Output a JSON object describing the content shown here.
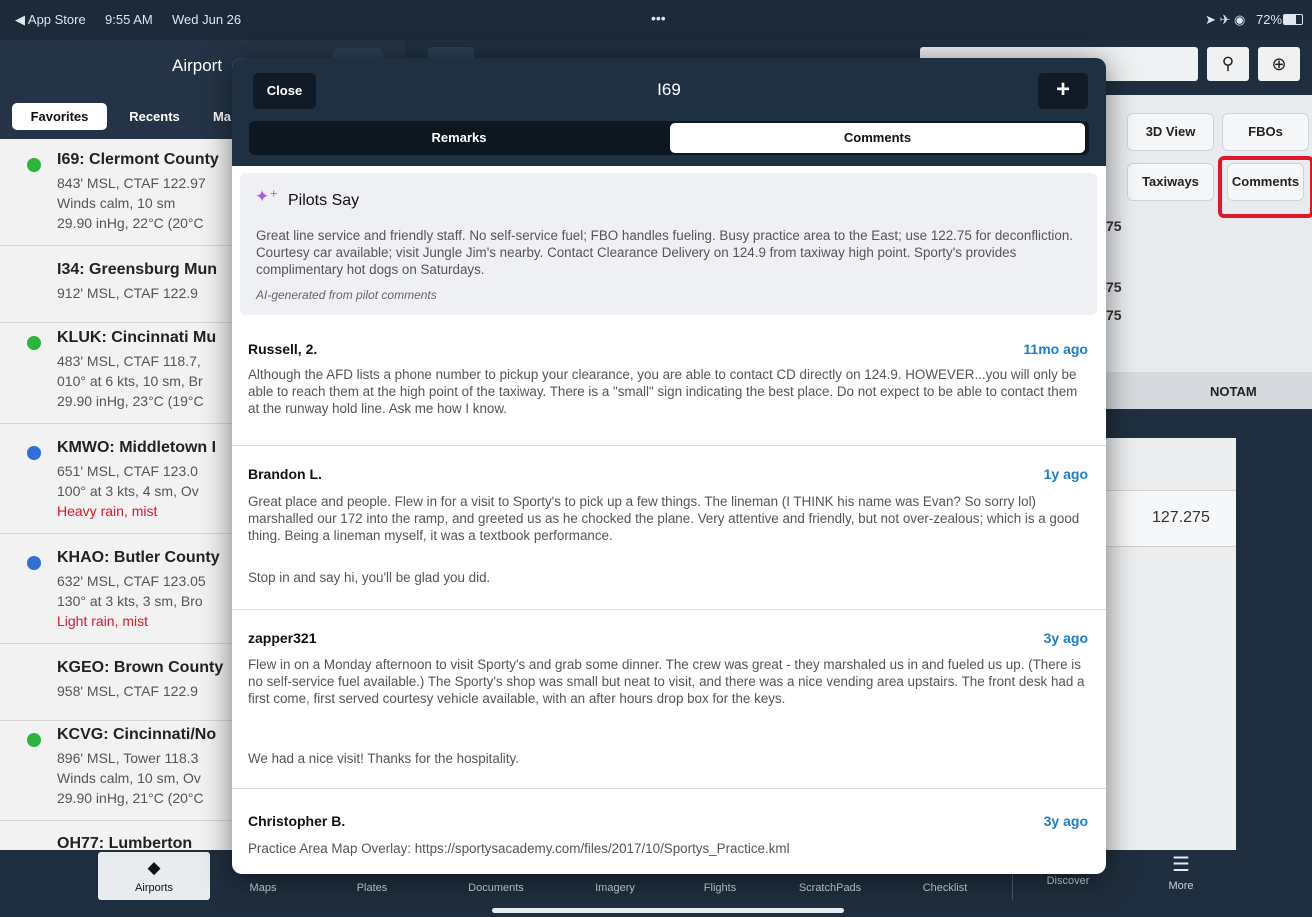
{
  "status_bar": {
    "back_label": "◀ App Store",
    "time": "9:55 AM",
    "date": "Wed Jun 26",
    "dots": "•••",
    "battery": "72%"
  },
  "left_panel": {
    "title": "Airport",
    "segments": [
      "Favorites",
      "Recents",
      "Ma"
    ],
    "airports": [
      {
        "name": "I69: Clermont County",
        "lines": [
          "843' MSL, CTAF 122.97",
          "Winds calm, 10 sm",
          "29.90 inHg, 22°C (20°C"
        ],
        "dot": "#2bb53c"
      },
      {
        "name": "I34: Greensburg Mun",
        "lines": [
          "912' MSL, CTAF 122.9"
        ],
        "dot": ""
      },
      {
        "name": "KLUK: Cincinnati Mu",
        "lines": [
          "483' MSL, CTAF 118.7,",
          "010° at 6 kts, 10 sm, Br",
          "29.90 inHg, 23°C (19°C"
        ],
        "dot": "#2bb53c"
      },
      {
        "name": "KMWO: Middletown I",
        "lines": [
          "651' MSL, CTAF 123.0",
          "100° at 3 kts, 4 sm, Ov",
          "Heavy rain, mist"
        ],
        "dot": "#2f6fd6"
      },
      {
        "name": "KHAO: Butler County",
        "lines": [
          "632' MSL, CTAF 123.05",
          "130° at 3 kts, 3 sm, Bro",
          "Light rain, mist"
        ],
        "dot": "#2f6fd6"
      },
      {
        "name": "KGEO: Brown County",
        "lines": [
          "958' MSL, CTAF 122.9"
        ],
        "dot": ""
      },
      {
        "name": "KCVG: Cincinnati/No",
        "lines": [
          "896' MSL, Tower 118.3",
          "Winds calm, 10 sm, Ov",
          "29.90 inHg, 21°C (20°C"
        ],
        "dot": "#2bb53c"
      },
      {
        "name": "OH77: Lumberton",
        "lines": [],
        "dot": ""
      }
    ]
  },
  "right_panel": {
    "buttons": [
      "3D View",
      "FBOs",
      "Taxiways",
      "Comments"
    ],
    "freq_fragments": [
      "75",
      "75",
      "75"
    ],
    "notam_label": "NOTAM",
    "freq_value": "127.275"
  },
  "modal": {
    "close_label": "Close",
    "title": "I69",
    "add_label": "+",
    "tabs": [
      "Remarks",
      "Comments"
    ],
    "pilots_say": {
      "title": "Pilots Say",
      "text": "Great line service and friendly staff. No self-service fuel; FBO handles fueling. Busy practice area to the East; use 122.75 for deconfliction. Courtesy car available; visit Jungle Jim's nearby. Contact Clearance Delivery on 124.9 from taxiway high point. Sporty's provides complimentary hot dogs on Saturdays.",
      "footnote": "AI-generated from pilot comments"
    },
    "comments": [
      {
        "author": "Russell, 2.",
        "age": "11mo ago",
        "paragraphs": [
          "Although the AFD lists a phone number to pickup your clearance, you are able to contact CD directly on 124.9. HOWEVER...you will only be able to reach them at the high point of the taxiway. There is a \"small\" sign indicating the best place. Do not expect to be able to contact them at the runway hold line. Ask me how I know."
        ]
      },
      {
        "author": "Brandon L.",
        "age": "1y ago",
        "paragraphs": [
          "Great place and people. Flew in for a visit to Sporty's to pick up a few things. The lineman (I THINK his name was Evan? So sorry lol) marshalled our 172 into the ramp, and greeted us as he chocked the plane. Very attentive and friendly, but not over-zealous; which is a good thing. Being a lineman myself, it was a textbook performance.",
          "Stop in and say hi, you'll be glad you did."
        ]
      },
      {
        "author": "zapper321",
        "age": "3y ago",
        "paragraphs": [
          "Flew in on a Monday afternoon to visit Sporty's and grab some dinner. The crew was great - they marshaled us in and fueled us up. (There is no self-service fuel available.) The Sporty's shop was small but neat to visit, and there was a nice vending area upstairs. The front desk had a first come, first served courtesy vehicle available, with an after hours drop box for the keys.",
          "We had a nice visit! Thanks for the hospitality."
        ]
      },
      {
        "author": "Christopher B.",
        "age": "3y ago",
        "paragraphs": [
          "Practice Area Map Overlay: https://sportysacademy.com/files/2017/10/Sportys_Practice.kml"
        ]
      }
    ]
  },
  "tab_bar": [
    "Airports",
    "Maps",
    "Plates",
    "Documents",
    "Imagery",
    "Flights",
    "ScratchPads",
    "Checklist",
    "Discover",
    "More"
  ],
  "colors": {
    "accent": "#1b7fd1",
    "highlight": "#e0162b",
    "sparkle": "#a95be0"
  }
}
